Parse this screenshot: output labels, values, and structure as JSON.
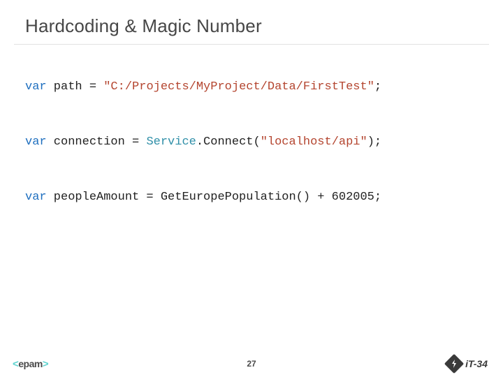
{
  "title": "Hardcoding & Magic Number",
  "code": {
    "l1": {
      "kw": "var",
      "text1": " path = ",
      "str": "\"C:/Projects/MyProject/Data/FirstTest\"",
      "text2": ";"
    },
    "l2": {
      "kw": "var",
      "text1": " connection = ",
      "cls": "Service",
      "text2": ".Connect(",
      "str": "\"localhost/api\"",
      "text3": ");"
    },
    "l3": {
      "kw": "var",
      "text1": " peopleAmount = GetEuropePopulation() + 602005;"
    }
  },
  "footer": {
    "left_bracket": "<",
    "brand": "epam",
    "right_bracket": ">",
    "page": "27",
    "right_label": "iT-34"
  }
}
